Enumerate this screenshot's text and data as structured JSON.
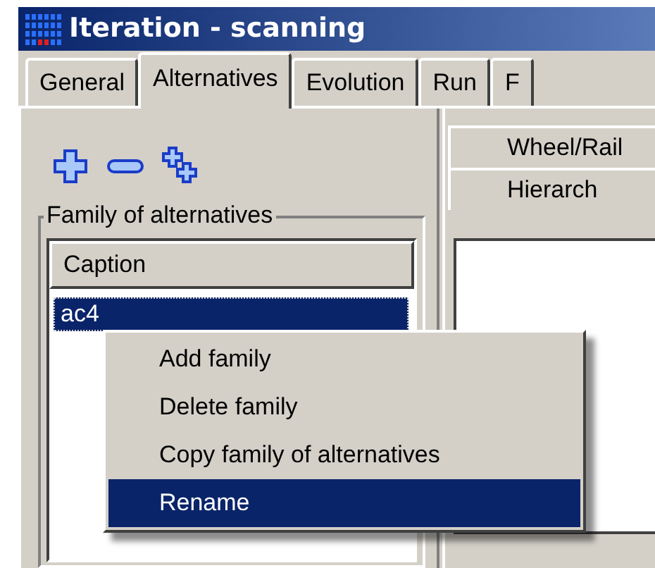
{
  "window": {
    "title": "Iteration - scanning"
  },
  "tabs": [
    {
      "label": "General",
      "selected": false
    },
    {
      "label": "Alternatives",
      "selected": true
    },
    {
      "label": "Evolution",
      "selected": false
    },
    {
      "label": "Run",
      "selected": false
    },
    {
      "label": "F",
      "selected": false
    }
  ],
  "toolbar": [
    {
      "kind": "add"
    },
    {
      "kind": "remove"
    },
    {
      "kind": "add-child"
    }
  ],
  "family_group": {
    "title": "Family of alternatives",
    "columns": [
      "Caption"
    ],
    "rows": [
      {
        "caption": "ac4",
        "selected": true
      }
    ]
  },
  "right_panel": {
    "tabs": [
      {
        "label": "Wheel/Rail"
      },
      {
        "label": "Hierarch"
      }
    ]
  },
  "context_menu": [
    {
      "label": "Add family",
      "selected": false
    },
    {
      "label": "Delete family",
      "selected": false
    },
    {
      "label": "Copy family of alternatives",
      "selected": false
    },
    {
      "label": "Rename",
      "selected": true
    }
  ]
}
